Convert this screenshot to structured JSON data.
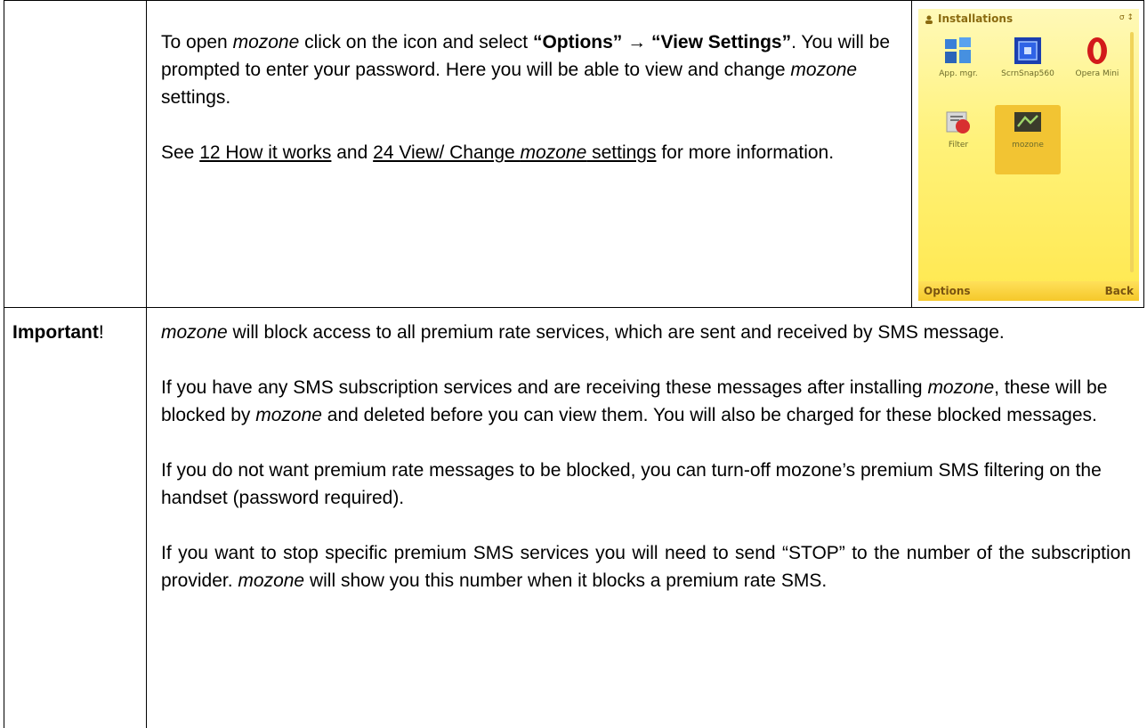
{
  "row1": {
    "p1": {
      "a": "To open ",
      "b_italic": "mozone",
      "c": " click on the icon and select ",
      "d_bold": "“Options”",
      "arrow": " → ",
      "e_bold": "“View Settings”",
      "f": ". You will be prompted to enter your password. Here you will be able to view and change ",
      "g_italic": "mozone",
      "h": " settings."
    },
    "p2": {
      "a": "See ",
      "link1": "12 How it works",
      "b": " and ",
      "link2_pre": "24 View/ Change ",
      "link2_italic": "mozone",
      "link2_post": " settings",
      "c": " for more information."
    }
  },
  "phone": {
    "title": "Installations",
    "status": "σ ↕",
    "apps": [
      {
        "label": "App. mgr.",
        "icon": "app-manager-icon"
      },
      {
        "label": "ScrnSnap560",
        "icon": "screensnap-icon"
      },
      {
        "label": "Opera Mini",
        "icon": "opera-icon"
      },
      {
        "label": "Filter",
        "icon": "filter-icon"
      },
      {
        "label": "mozone",
        "icon": "mozone-icon"
      }
    ],
    "softkey_left": "Options",
    "softkey_right": "Back"
  },
  "row2": {
    "label_bold": "Important",
    "label_tail": "!",
    "p1": {
      "a_italic": "mozone",
      "b": " will block access to all premium rate services, which are sent and received by SMS message."
    },
    "p2": {
      "a": "If you have any SMS subscription services and are receiving these messages after installing ",
      "b_italic": "mozone",
      "c": ", these will be blocked by ",
      "d_italic": "mozone",
      "e": " and deleted before you can view them. You will also be charged for these blocked messages."
    },
    "p3": {
      "a": "If you do not want premium rate messages to be blocked, you can turn-off mozone’s premium SMS filtering on the handset (password required)."
    },
    "p4": {
      "a": "If you want to stop specific premium SMS services you will need to send “STOP” to the number of the subscription provider. ",
      "b_italic": "mozone",
      "c": " will show you this number when it blocks a premium rate SMS."
    }
  }
}
